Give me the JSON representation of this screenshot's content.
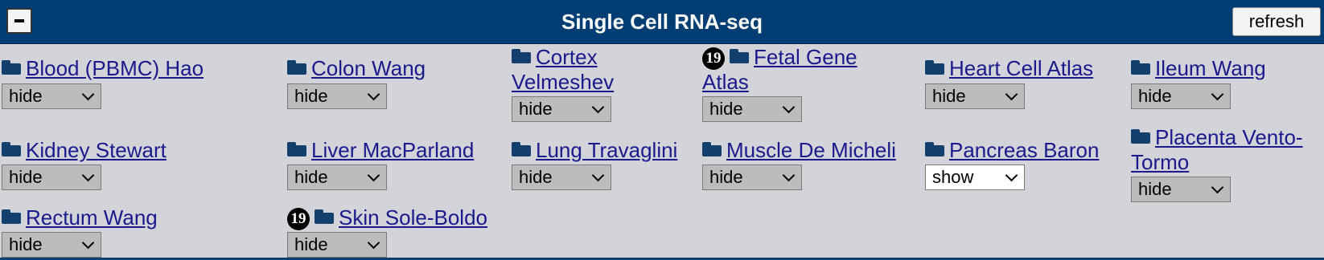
{
  "header": {
    "title": "Single Cell RNA-seq",
    "collapse_label": "−",
    "refresh_label": "refresh"
  },
  "tracks": [
    {
      "label": "Blood (PBMC) Hao",
      "visibility": "hide"
    },
    {
      "label": "Colon Wang",
      "visibility": "hide"
    },
    {
      "label": "Cortex Velmeshev",
      "visibility": "hide"
    },
    {
      "label": "Fetal Gene Atlas",
      "visibility": "hide",
      "badge": "19"
    },
    {
      "label": "Heart Cell Atlas",
      "visibility": "hide"
    },
    {
      "label": "Ileum Wang",
      "visibility": "hide"
    },
    {
      "label": "Kidney Stewart",
      "visibility": "hide"
    },
    {
      "label": "Liver MacParland",
      "visibility": "hide"
    },
    {
      "label": "Lung Travaglini",
      "visibility": "hide"
    },
    {
      "label": "Muscle De Micheli",
      "visibility": "hide"
    },
    {
      "label": "Pancreas Baron",
      "visibility": "show"
    },
    {
      "label": "Placenta Vento-Tormo",
      "visibility": "hide"
    },
    {
      "label": "Rectum Wang",
      "visibility": "hide"
    },
    {
      "label": "Skin Sole-Boldo",
      "visibility": "hide",
      "badge": "19"
    }
  ],
  "colors": {
    "header_bg": "#003d73",
    "panel_bg": "#d2d4d9",
    "link": "#1a1a8c",
    "folder_icon": "#123f6b"
  }
}
